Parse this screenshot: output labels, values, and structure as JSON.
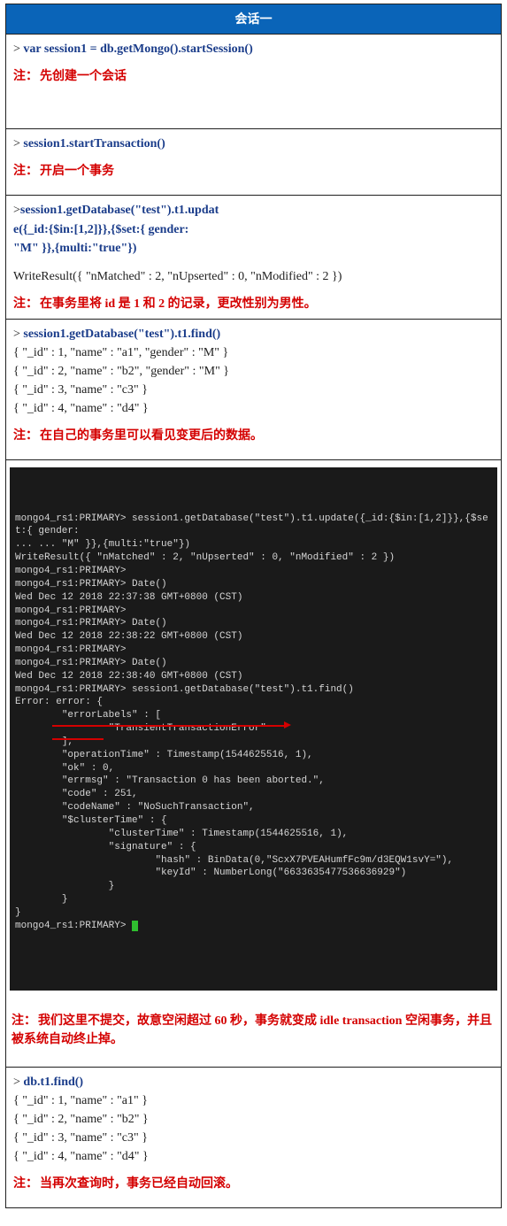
{
  "header": {
    "title": "会话一"
  },
  "row1": {
    "prompt": "> ",
    "cmd_prefix": "var",
    "cmd": " session1 = db.getMongo().startSession()",
    "note_label": "注：",
    "note_text": "先创建一个会话"
  },
  "row2": {
    "prompt": "> ",
    "cmd": "session1.startTransaction()",
    "note_label": "注：",
    "note_text": "开启一个事务"
  },
  "row3": {
    "prompt": ">",
    "cmd_line1": "session1.getDatabase(\"test\").t1.updat",
    "cmd_line2": "e({_id:{$in:[1,2]}},{$set:{ gender:",
    "cmd_line3": "\"M\" }},{multi:\"true\"})",
    "result": "WriteResult({ \"nMatched\" : 2, \"nUpserted\" : 0, \"nModified\" : 2 })",
    "note_label": "注：",
    "note_text": "在事务里将 id 是 1 和 2 的记录，更改性别为男性。"
  },
  "row4": {
    "prompt": "> ",
    "cmd": "session1.getDatabase(\"test\").t1.find()",
    "lines": [
      "{ \"_id\" : 1, \"name\" : \"a1\", \"gender\" : \"M\" }",
      "{ \"_id\" : 2, \"name\" : \"b2\", \"gender\" : \"M\" }",
      "{ \"_id\" : 3, \"name\" : \"c3\" }",
      "{ \"_id\" : 4, \"name\" : \"d4\" }"
    ],
    "note_label": "注：",
    "note_text": "在自己的事务里可以看见变更后的数据。"
  },
  "row5": {
    "terminal_lines": [
      "mongo4_rs1:PRIMARY> session1.getDatabase(\"test\").t1.update({_id:{$in:[1,2]}},{$set:{ gender:",
      "... ... \"M\" }},{multi:\"true\"})",
      "WriteResult({ \"nMatched\" : 2, \"nUpserted\" : 0, \"nModified\" : 2 })",
      "mongo4_rs1:PRIMARY>",
      "mongo4_rs1:PRIMARY> Date()",
      "Wed Dec 12 2018 22:37:38 GMT+0800 (CST)",
      "mongo4_rs1:PRIMARY>",
      "mongo4_rs1:PRIMARY> Date()",
      "Wed Dec 12 2018 22:38:22 GMT+0800 (CST)",
      "mongo4_rs1:PRIMARY>",
      "mongo4_rs1:PRIMARY> Date()",
      "Wed Dec 12 2018 22:38:40 GMT+0800 (CST)",
      "mongo4_rs1:PRIMARY> session1.getDatabase(\"test\").t1.find()",
      "Error: error: {",
      "        \"errorLabels\" : [",
      "                \"TransientTransactionError\"",
      "        ],",
      "        \"operationTime\" : Timestamp(1544625516, 1),",
      "        \"ok\" : 0,",
      "        \"errmsg\" : \"Transaction 0 has been aborted.\",",
      "        \"code\" : 251,",
      "        \"codeName\" : \"NoSuchTransaction\",",
      "        \"$clusterTime\" : {",
      "                \"clusterTime\" : Timestamp(1544625516, 1),",
      "                \"signature\" : {",
      "                        \"hash\" : BinData(0,\"ScxX7PVEAHumfFc9m/d3EQW1svY=\"),",
      "                        \"keyId\" : NumberLong(\"6633635477536636929\")",
      "                }",
      "        }",
      "}",
      "mongo4_rs1:PRIMARY> "
    ],
    "note_label": "注：",
    "note_text": "我们这里不提交，故意空闲超过 60 秒，事务就变成 idle transaction 空闲事务，并且被系统自动终止掉。"
  },
  "row6": {
    "prompt": "> ",
    "cmd": "db.t1.find()",
    "lines": [
      "{ \"_id\" : 1, \"name\" : \"a1\" }",
      "{ \"_id\" : 2, \"name\" : \"b2\" }",
      "{ \"_id\" : 3, \"name\" : \"c3\" }",
      "{ \"_id\" : 4, \"name\" : \"d4\" }"
    ],
    "note_label": "注：",
    "note_text": "当再次查询时，事务已经自动回滚。"
  }
}
